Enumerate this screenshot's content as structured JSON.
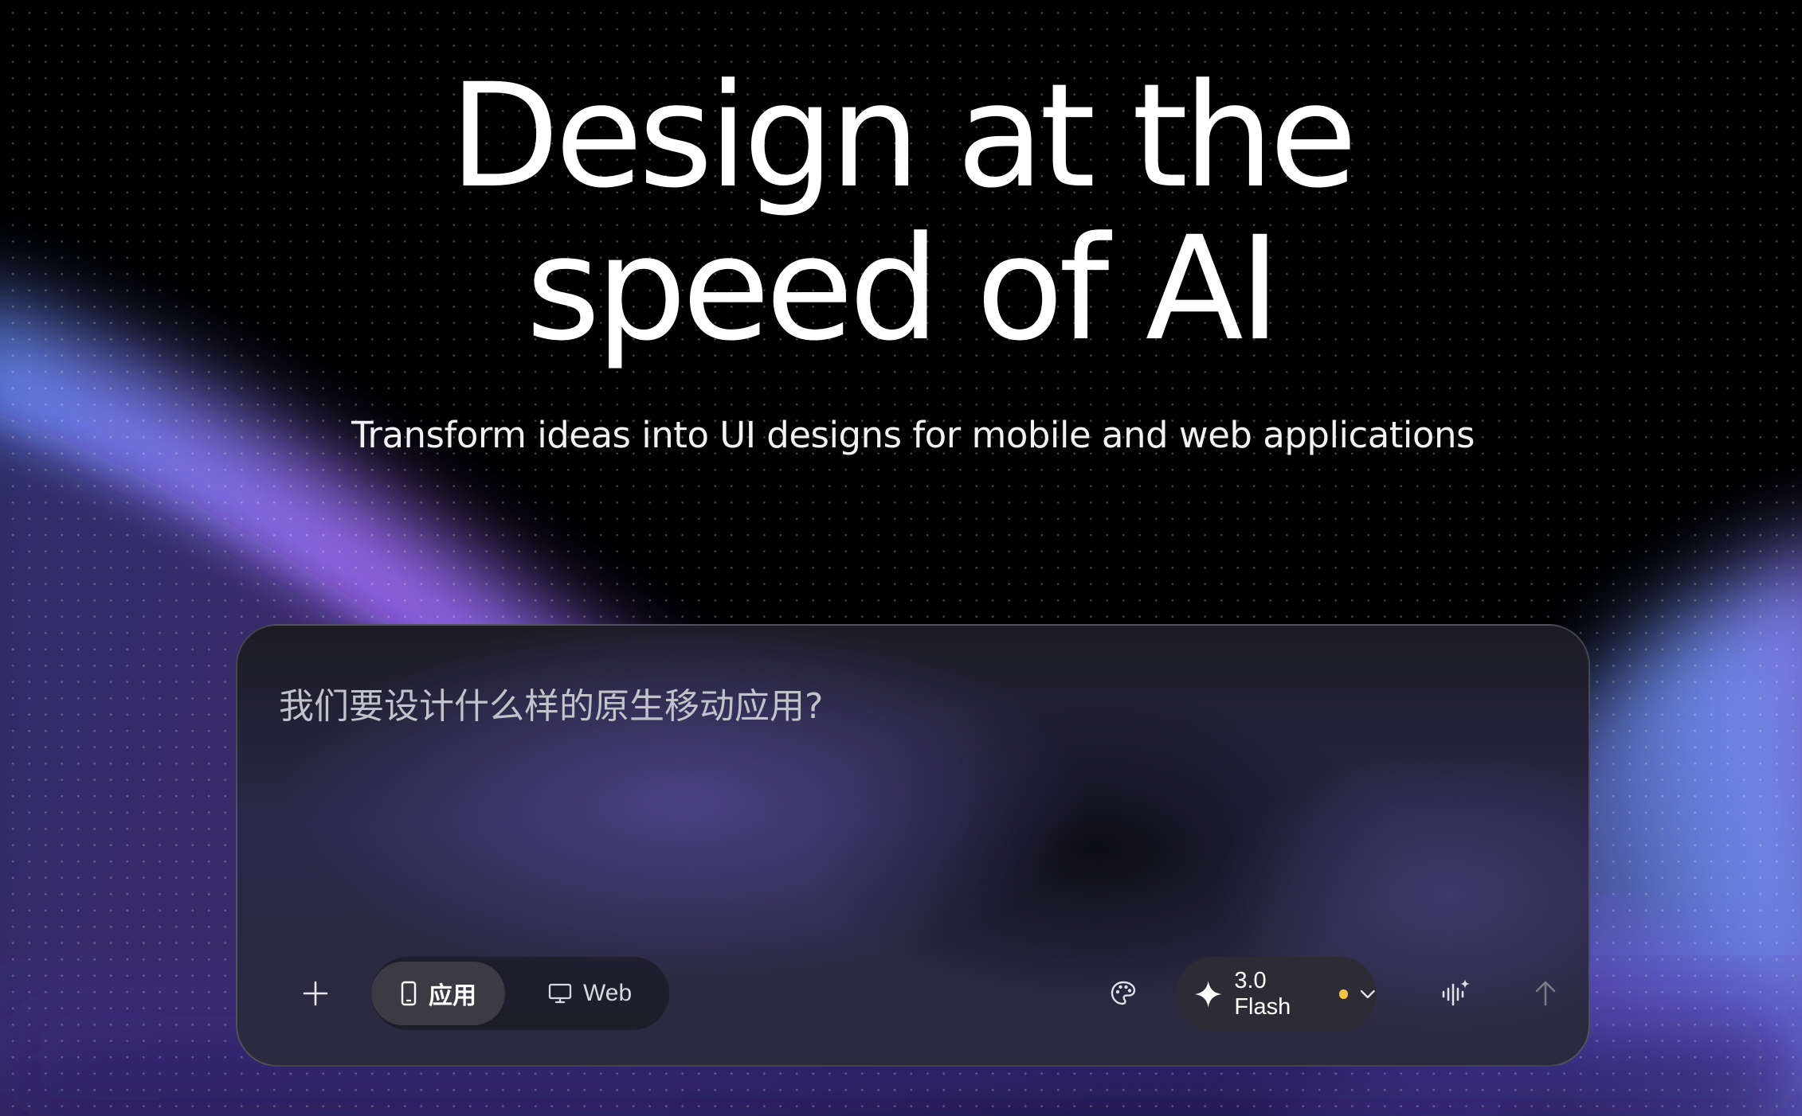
{
  "hero": {
    "title_line1": "Design at the",
    "title_line2": "speed of AI",
    "subtitle": "Transform ideas into UI designs for mobile and web applications"
  },
  "prompt": {
    "placeholder": "我们要设计什么样的原生移动应用?",
    "value": ""
  },
  "toolbar": {
    "add_icon": "plus-icon",
    "platform_toggle": [
      {
        "label": "应用",
        "icon": "phone-icon",
        "selected": true
      },
      {
        "label": "Web",
        "icon": "monitor-icon",
        "selected": false
      }
    ],
    "theme_icon": "palette-icon",
    "model": {
      "label": "3.0 Flash",
      "icon": "sparkle-icon",
      "status_color": "#f5c542",
      "dropdown_icon": "chevron-down-icon"
    },
    "voice_icon": "voice-sparkle-icon",
    "send_icon": "arrow-up-icon"
  },
  "colors": {
    "background": "#000000",
    "glow_purple": "#8b6cf0",
    "glow_blue": "#6fa2f2",
    "accent_dot": "#f5c542"
  }
}
